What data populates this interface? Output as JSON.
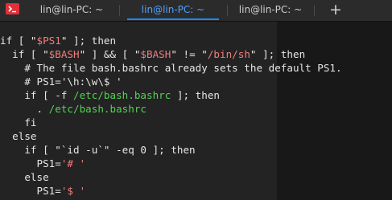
{
  "tabbar": {
    "tabs": [
      {
        "label": "lin@lin-PC: ~",
        "active": false
      },
      {
        "label": "lin@lin-PC: ~",
        "active": true
      },
      {
        "label": "lin@lin-PC: ~",
        "active": false
      }
    ],
    "new_tab_symbol": "+"
  },
  "colors": {
    "active_tab": "#1a8cff",
    "string": "#f07d7d",
    "path": "#53d153",
    "background": "#232323"
  },
  "terminal": {
    "lines": [
      [
        {
          "t": "if [ \"",
          "c": "kw"
        },
        {
          "t": "$PS1",
          "c": "str"
        },
        {
          "t": "\" ]; then",
          "c": "kw"
        }
      ],
      [
        {
          "t": "  if [ \"",
          "c": "kw"
        },
        {
          "t": "$BASH",
          "c": "str"
        },
        {
          "t": "\" ] && [ \"",
          "c": "kw"
        },
        {
          "t": "$BASH",
          "c": "str"
        },
        {
          "t": "\" != \"",
          "c": "kw"
        },
        {
          "t": "/bin/sh",
          "c": "str"
        },
        {
          "t": "\" ]; then",
          "c": "kw"
        }
      ],
      [
        {
          "t": "    # The file bash.bashrc already sets the default PS1.",
          "c": "cmt"
        }
      ],
      [
        {
          "t": "    # PS1='\\h:\\w\\$ '",
          "c": "cmt"
        }
      ],
      [
        {
          "t": "    if [ -f ",
          "c": "kw"
        },
        {
          "t": "/etc/bash.bashrc",
          "c": "cmd"
        },
        {
          "t": " ]; then",
          "c": "kw"
        }
      ],
      [
        {
          "t": "      . ",
          "c": "kw"
        },
        {
          "t": "/etc/bash.bashrc",
          "c": "cmd"
        }
      ],
      [
        {
          "t": "    fi",
          "c": "kw"
        }
      ],
      [
        {
          "t": "  else",
          "c": "kw"
        }
      ],
      [
        {
          "t": "    if [ \"`",
          "c": "kw"
        },
        {
          "t": "id -u",
          "c": "kw"
        },
        {
          "t": "`\" -eq 0 ]; then",
          "c": "kw"
        }
      ],
      [
        {
          "t": "      PS1=",
          "c": "kw"
        },
        {
          "t": "'# '",
          "c": "str"
        }
      ],
      [
        {
          "t": "    else",
          "c": "kw"
        }
      ],
      [
        {
          "t": "      PS1=",
          "c": "kw"
        },
        {
          "t": "'$ '",
          "c": "str"
        }
      ]
    ]
  }
}
